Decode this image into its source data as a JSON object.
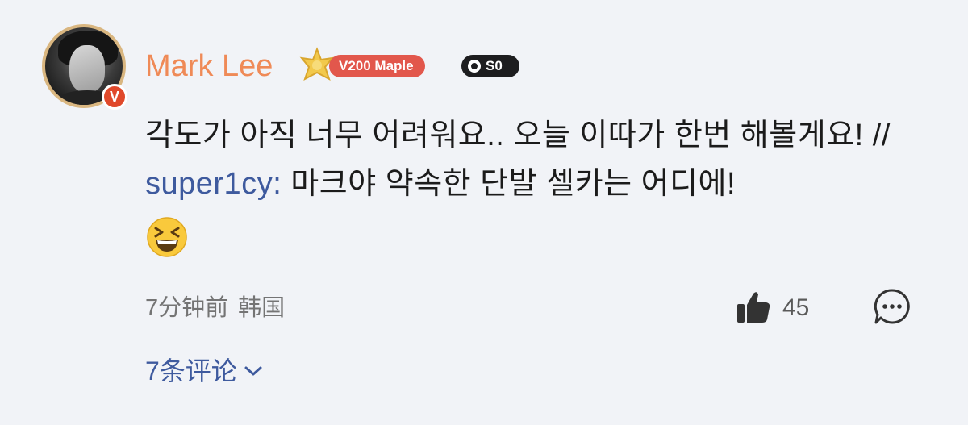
{
  "comment": {
    "author": {
      "name": "Mark Lee",
      "level_badge": "V200 Maple",
      "svip_badge": "S0",
      "verified_badge": "V",
      "avatar_icon": "user-avatar",
      "crown_icon": "crown-icon"
    },
    "body": {
      "line_text": "각도가 아직 너무 어려워요.. 오늘 이따가 한번 해볼게요! // ",
      "mention": "super1cy:",
      "quoted_text": " 마크야 약속한 단발 셀카는 어디에!",
      "emoji": "laughing-emoji"
    },
    "meta": {
      "time": "7分钟前",
      "location": "韩国"
    },
    "actions": {
      "like_count": "45",
      "like_icon": "thumbs-up-icon",
      "reply_icon": "chat-bubble-icon"
    },
    "replies_label": "7条评论"
  },
  "colors": {
    "background": "#f1f3f7",
    "name": "#ef8a57",
    "link": "#3e5a9e",
    "level_badge": "#e2574c",
    "verified": "#e0492b"
  }
}
